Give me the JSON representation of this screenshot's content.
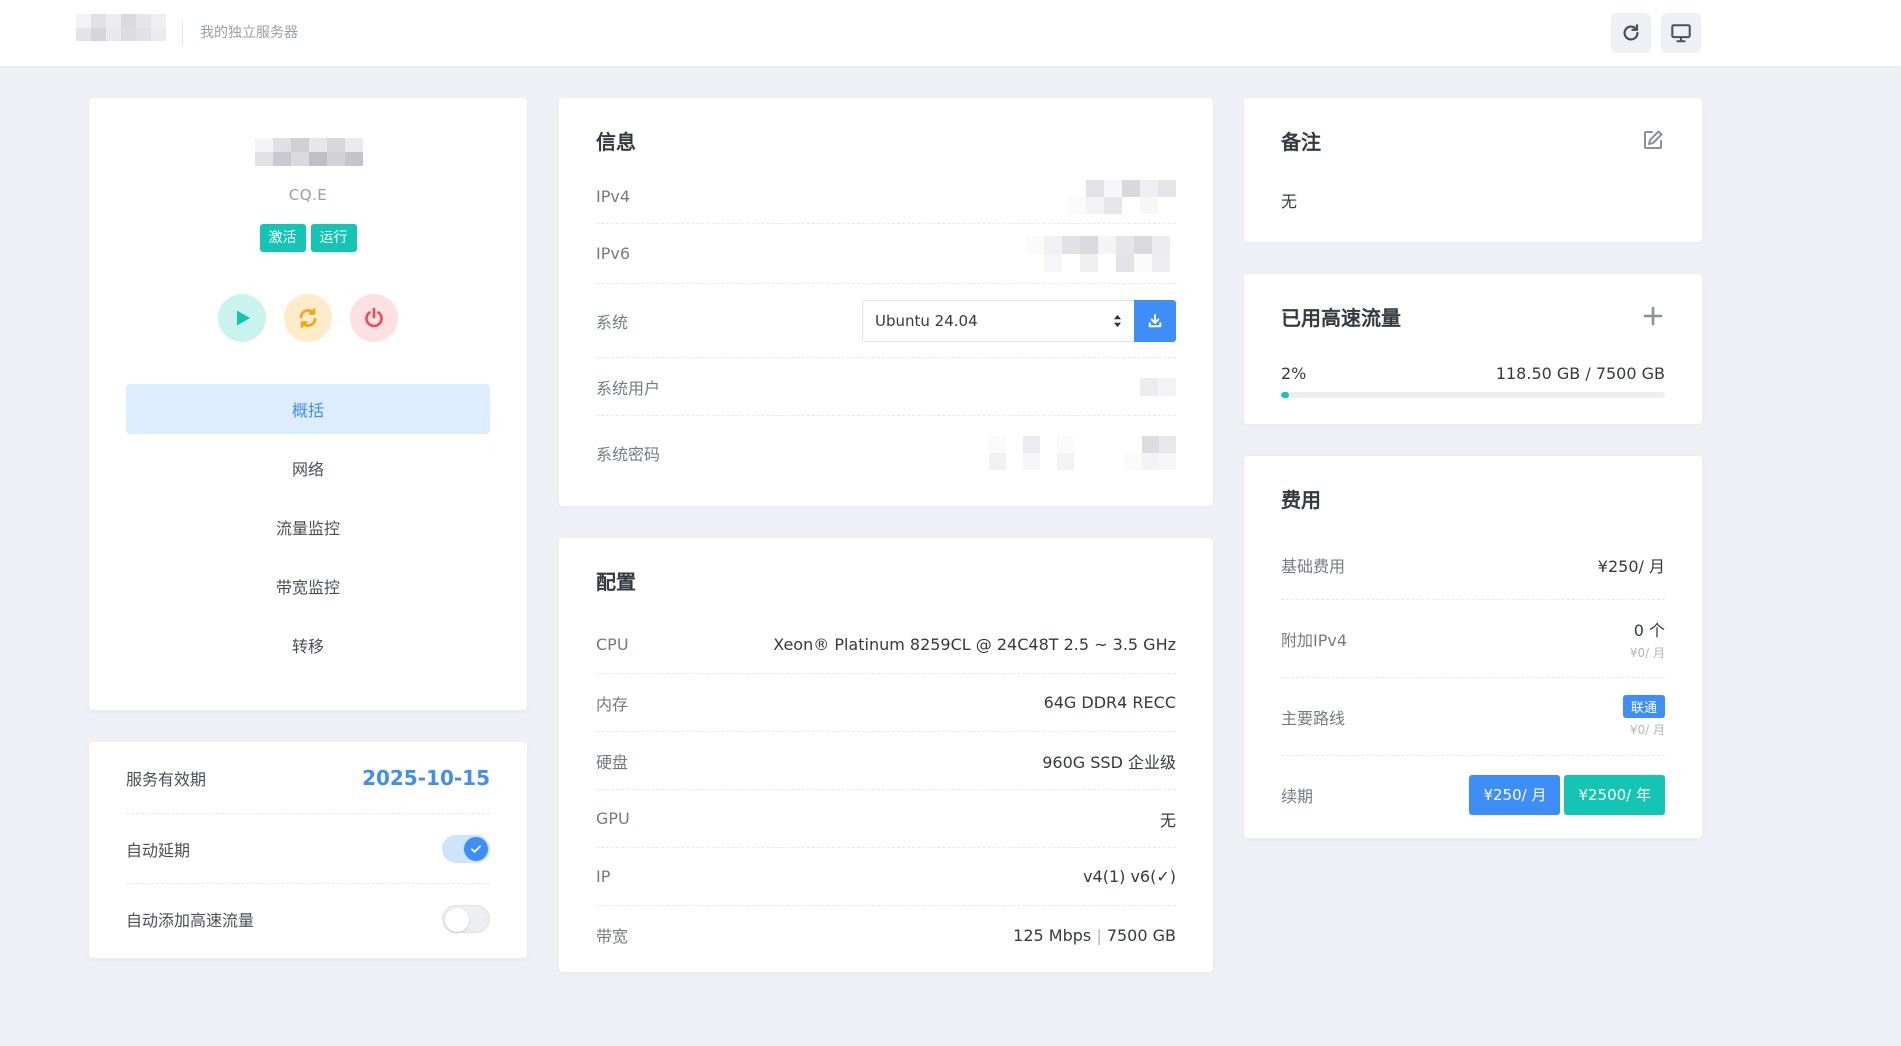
{
  "header": {
    "subtitle": "我的独立服务器",
    "refresh_icon": "refresh-icon",
    "monitor_icon": "monitor-icon"
  },
  "profile": {
    "server_id": "CQ.E",
    "badges": [
      "激活",
      "运行"
    ],
    "actions": [
      "play-icon",
      "restart-icon",
      "power-icon"
    ],
    "nav": [
      "概括",
      "网络",
      "流量监控",
      "带宽监控",
      "转移"
    ],
    "active_nav": "概括"
  },
  "validity": {
    "expiry_label": "服务有效期",
    "expiry_value": "2025-10-15",
    "auto_extend_label": "自动延期",
    "auto_extend_on": true,
    "auto_traffic_label": "自动添加高速流量",
    "auto_traffic_on": false
  },
  "info": {
    "title": "信息",
    "ipv4_label": "IPv4",
    "ipv6_label": "IPv6",
    "os_label": "系统",
    "os_value": "Ubuntu 24.04",
    "user_label": "系统用户",
    "password_label": "系统密码"
  },
  "config": {
    "title": "配置",
    "rows": [
      {
        "label": "CPU",
        "value": "Xeon® Platinum 8259CL @ 24C48T 2.5 ~ 3.5 GHz"
      },
      {
        "label": "内存",
        "value": "64G DDR4 RECC"
      },
      {
        "label": "硬盘",
        "value": "960G SSD 企业级"
      },
      {
        "label": "GPU",
        "value": "无"
      },
      {
        "label": "IP",
        "value": "v4(1) v6(✓)"
      }
    ],
    "bandwidth_label": "带宽",
    "bandwidth_speed": "125 Mbps",
    "bandwidth_sep": "|",
    "bandwidth_traffic": "7500 GB"
  },
  "notes": {
    "title": "备注",
    "value": "无",
    "edit_icon": "edit-icon"
  },
  "traffic": {
    "title": "已用高速流量",
    "percent_text": "2%",
    "percent": 2,
    "usage": "118.50 GB / 7500 GB",
    "add_icon": "plus-icon"
  },
  "fees": {
    "title": "费用",
    "base_label": "基础费用",
    "base_value": "¥250/ 月",
    "ipv4_label": "附加IPv4",
    "ipv4_count": "0 个",
    "ipv4_price": "¥0/ 月",
    "route_label": "主要路线",
    "route_tag": "联通",
    "route_price": "¥0/ 月",
    "renew_label": "续期",
    "renew_monthly": "¥250/ 月",
    "renew_yearly": "¥2500/ 年"
  },
  "colors": {
    "accent_blue": "#3e8ef7",
    "accent_teal": "#15c5b3",
    "page_bg": "#eef0f6"
  }
}
